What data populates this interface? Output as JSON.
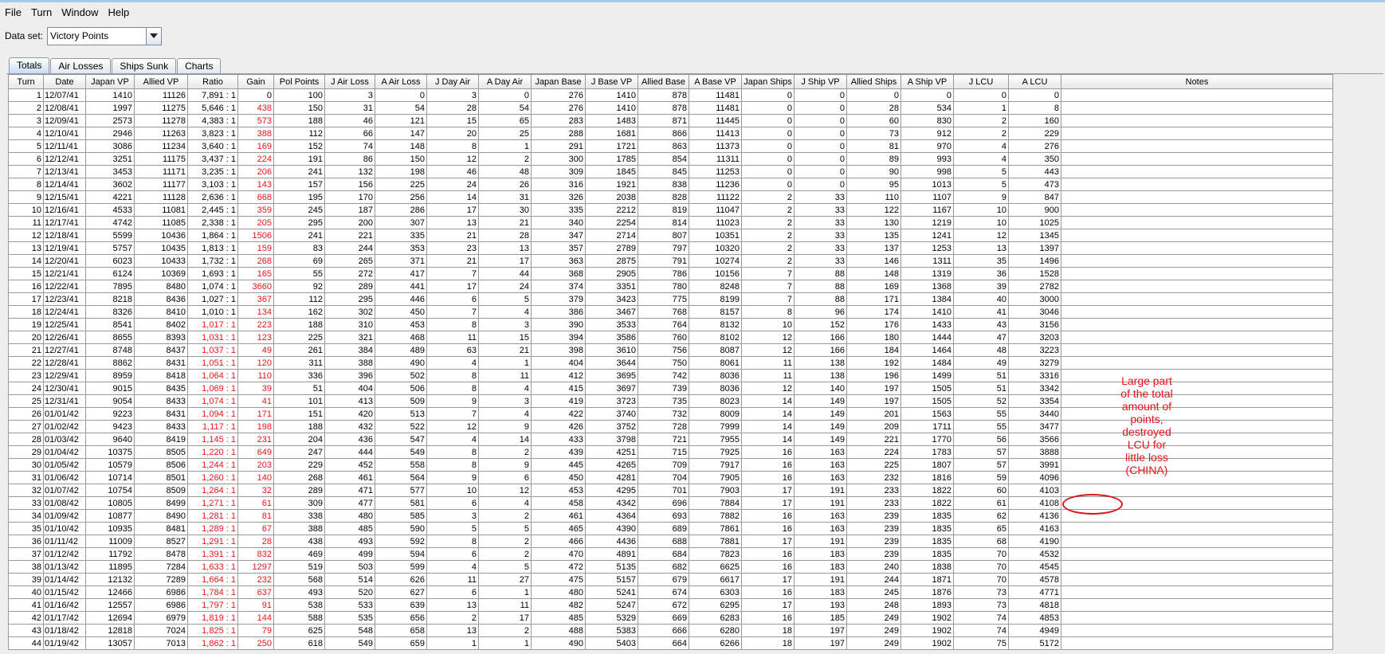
{
  "menu": [
    "File",
    "Turn",
    "Window",
    "Help"
  ],
  "toolbar": {
    "dataset_label": "Data set:",
    "dataset_value": "Victory Points"
  },
  "tabs": [
    "Totals",
    "Air Losses",
    "Ships Sunk",
    "Charts"
  ],
  "table": {
    "columns": [
      "Turn",
      "Date",
      "Japan VP",
      "Allied VP",
      "Ratio",
      "Gain",
      "Pol Points",
      "J Air Loss",
      "A Air Loss",
      "J Day Air",
      "A Day Air",
      "Japan Base",
      "J Base VP",
      "Allied Base",
      "A Base VP",
      "Japan Ships",
      "J Ship VP",
      "Allied Ships",
      "A Ship VP",
      "J LCU",
      "A LCU",
      "Notes"
    ],
    "rows": [
      [
        "1",
        "12/07/41",
        "1410",
        "11126",
        "7,891 : 1",
        "0",
        "100",
        "3",
        "0",
        "3",
        "0",
        "276",
        "1410",
        "878",
        "11481",
        "0",
        "0",
        "0",
        "0",
        "0",
        "0",
        ""
      ],
      [
        "2",
        "12/08/41",
        "1997",
        "11275",
        "5,646 : 1",
        "438",
        "150",
        "31",
        "54",
        "28",
        "54",
        "276",
        "1410",
        "878",
        "11481",
        "0",
        "0",
        "28",
        "534",
        "1",
        "8",
        ""
      ],
      [
        "3",
        "12/09/41",
        "2573",
        "11278",
        "4,383 : 1",
        "573",
        "188",
        "46",
        "121",
        "15",
        "65",
        "283",
        "1483",
        "871",
        "11445",
        "0",
        "0",
        "60",
        "830",
        "2",
        "160",
        ""
      ],
      [
        "4",
        "12/10/41",
        "2946",
        "11263",
        "3,823 : 1",
        "388",
        "112",
        "66",
        "147",
        "20",
        "25",
        "288",
        "1681",
        "866",
        "11413",
        "0",
        "0",
        "73",
        "912",
        "2",
        "229",
        ""
      ],
      [
        "5",
        "12/11/41",
        "3086",
        "11234",
        "3,640 : 1",
        "169",
        "152",
        "74",
        "148",
        "8",
        "1",
        "291",
        "1721",
        "863",
        "11373",
        "0",
        "0",
        "81",
        "970",
        "4",
        "276",
        ""
      ],
      [
        "6",
        "12/12/41",
        "3251",
        "11175",
        "3,437 : 1",
        "224",
        "191",
        "86",
        "150",
        "12",
        "2",
        "300",
        "1785",
        "854",
        "11311",
        "0",
        "0",
        "89",
        "993",
        "4",
        "350",
        ""
      ],
      [
        "7",
        "12/13/41",
        "3453",
        "11171",
        "3,235 : 1",
        "206",
        "241",
        "132",
        "198",
        "46",
        "48",
        "309",
        "1845",
        "845",
        "11253",
        "0",
        "0",
        "90",
        "998",
        "5",
        "443",
        ""
      ],
      [
        "8",
        "12/14/41",
        "3602",
        "11177",
        "3,103 : 1",
        "143",
        "157",
        "156",
        "225",
        "24",
        "26",
        "316",
        "1921",
        "838",
        "11236",
        "0",
        "0",
        "95",
        "1013",
        "5",
        "473",
        ""
      ],
      [
        "9",
        "12/15/41",
        "4221",
        "11128",
        "2,636 : 1",
        "668",
        "195",
        "170",
        "256",
        "14",
        "31",
        "326",
        "2038",
        "828",
        "11122",
        "2",
        "33",
        "110",
        "1107",
        "9",
        "847",
        ""
      ],
      [
        "10",
        "12/16/41",
        "4533",
        "11081",
        "2,445 : 1",
        "359",
        "245",
        "187",
        "286",
        "17",
        "30",
        "335",
        "2212",
        "819",
        "11047",
        "2",
        "33",
        "122",
        "1167",
        "10",
        "900",
        ""
      ],
      [
        "11",
        "12/17/41",
        "4742",
        "11085",
        "2,338 : 1",
        "205",
        "295",
        "200",
        "307",
        "13",
        "21",
        "340",
        "2254",
        "814",
        "11023",
        "2",
        "33",
        "130",
        "1219",
        "10",
        "1025",
        ""
      ],
      [
        "12",
        "12/18/41",
        "5599",
        "10436",
        "1,864 : 1",
        "1506",
        "241",
        "221",
        "335",
        "21",
        "28",
        "347",
        "2714",
        "807",
        "10351",
        "2",
        "33",
        "135",
        "1241",
        "12",
        "1345",
        ""
      ],
      [
        "13",
        "12/19/41",
        "5757",
        "10435",
        "1,813 : 1",
        "159",
        "83",
        "244",
        "353",
        "23",
        "13",
        "357",
        "2789",
        "797",
        "10320",
        "2",
        "33",
        "137",
        "1253",
        "13",
        "1397",
        ""
      ],
      [
        "14",
        "12/20/41",
        "6023",
        "10433",
        "1,732 : 1",
        "268",
        "69",
        "265",
        "371",
        "21",
        "17",
        "363",
        "2875",
        "791",
        "10274",
        "2",
        "33",
        "146",
        "1311",
        "35",
        "1496",
        ""
      ],
      [
        "15",
        "12/21/41",
        "6124",
        "10369",
        "1,693 : 1",
        "165",
        "55",
        "272",
        "417",
        "7",
        "44",
        "368",
        "2905",
        "786",
        "10156",
        "7",
        "88",
        "148",
        "1319",
        "36",
        "1528",
        ""
      ],
      [
        "16",
        "12/22/41",
        "7895",
        "8480",
        "1,074 : 1",
        "3660",
        "92",
        "289",
        "441",
        "17",
        "24",
        "374",
        "3351",
        "780",
        "8248",
        "7",
        "88",
        "169",
        "1368",
        "39",
        "2782",
        ""
      ],
      [
        "17",
        "12/23/41",
        "8218",
        "8436",
        "1,027 : 1",
        "367",
        "112",
        "295",
        "446",
        "6",
        "5",
        "379",
        "3423",
        "775",
        "8199",
        "7",
        "88",
        "171",
        "1384",
        "40",
        "3000",
        ""
      ],
      [
        "18",
        "12/24/41",
        "8326",
        "8410",
        "1,010 : 1",
        "134",
        "162",
        "302",
        "450",
        "7",
        "4",
        "386",
        "3467",
        "768",
        "8157",
        "8",
        "96",
        "174",
        "1410",
        "41",
        "3046",
        ""
      ],
      [
        "19",
        "12/25/41",
        "8541",
        "8402",
        "1,017 : 1",
        "223",
        "188",
        "310",
        "453",
        "8",
        "3",
        "390",
        "3533",
        "764",
        "8132",
        "10",
        "152",
        "176",
        "1433",
        "43",
        "3156",
        ""
      ],
      [
        "20",
        "12/26/41",
        "8655",
        "8393",
        "1,031 : 1",
        "123",
        "225",
        "321",
        "468",
        "11",
        "15",
        "394",
        "3586",
        "760",
        "8102",
        "12",
        "166",
        "180",
        "1444",
        "47",
        "3203",
        ""
      ],
      [
        "21",
        "12/27/41",
        "8748",
        "8437",
        "1,037 : 1",
        "49",
        "261",
        "384",
        "489",
        "63",
        "21",
        "398",
        "3610",
        "756",
        "8087",
        "12",
        "166",
        "184",
        "1464",
        "48",
        "3223",
        ""
      ],
      [
        "22",
        "12/28/41",
        "8862",
        "8431",
        "1,051 : 1",
        "120",
        "311",
        "388",
        "490",
        "4",
        "1",
        "404",
        "3644",
        "750",
        "8061",
        "11",
        "138",
        "192",
        "1484",
        "49",
        "3279",
        ""
      ],
      [
        "23",
        "12/29/41",
        "8959",
        "8418",
        "1,064 : 1",
        "110",
        "336",
        "396",
        "502",
        "8",
        "11",
        "412",
        "3695",
        "742",
        "8036",
        "11",
        "138",
        "196",
        "1499",
        "51",
        "3316",
        ""
      ],
      [
        "24",
        "12/30/41",
        "9015",
        "8435",
        "1,069 : 1",
        "39",
        "51",
        "404",
        "506",
        "8",
        "4",
        "415",
        "3697",
        "739",
        "8036",
        "12",
        "140",
        "197",
        "1505",
        "51",
        "3342",
        ""
      ],
      [
        "25",
        "12/31/41",
        "9054",
        "8433",
        "1,074 : 1",
        "41",
        "101",
        "413",
        "509",
        "9",
        "3",
        "419",
        "3723",
        "735",
        "8023",
        "14",
        "149",
        "197",
        "1505",
        "52",
        "3354",
        ""
      ],
      [
        "26",
        "01/01/42",
        "9223",
        "8431",
        "1,094 : 1",
        "171",
        "151",
        "420",
        "513",
        "7",
        "4",
        "422",
        "3740",
        "732",
        "8009",
        "14",
        "149",
        "201",
        "1563",
        "55",
        "3440",
        ""
      ],
      [
        "27",
        "01/02/42",
        "9423",
        "8433",
        "1,117 : 1",
        "198",
        "188",
        "432",
        "522",
        "12",
        "9",
        "426",
        "3752",
        "728",
        "7999",
        "14",
        "149",
        "209",
        "1711",
        "55",
        "3477",
        ""
      ],
      [
        "28",
        "01/03/42",
        "9640",
        "8419",
        "1,145 : 1",
        "231",
        "204",
        "436",
        "547",
        "4",
        "14",
        "433",
        "3798",
        "721",
        "7955",
        "14",
        "149",
        "221",
        "1770",
        "56",
        "3566",
        ""
      ],
      [
        "29",
        "01/04/42",
        "10375",
        "8505",
        "1,220 : 1",
        "649",
        "247",
        "444",
        "549",
        "8",
        "2",
        "439",
        "4251",
        "715",
        "7925",
        "16",
        "163",
        "224",
        "1783",
        "57",
        "3888",
        ""
      ],
      [
        "30",
        "01/05/42",
        "10579",
        "8506",
        "1,244 : 1",
        "203",
        "229",
        "452",
        "558",
        "8",
        "9",
        "445",
        "4265",
        "709",
        "7917",
        "16",
        "163",
        "225",
        "1807",
        "57",
        "3991",
        ""
      ],
      [
        "31",
        "01/06/42",
        "10714",
        "8501",
        "1,260 : 1",
        "140",
        "268",
        "461",
        "564",
        "9",
        "6",
        "450",
        "4281",
        "704",
        "7905",
        "16",
        "163",
        "232",
        "1816",
        "59",
        "4096",
        ""
      ],
      [
        "32",
        "01/07/42",
        "10754",
        "8509",
        "1,264 : 1",
        "32",
        "289",
        "471",
        "577",
        "10",
        "12",
        "453",
        "4295",
        "701",
        "7903",
        "17",
        "191",
        "233",
        "1822",
        "60",
        "4103",
        ""
      ],
      [
        "33",
        "01/08/42",
        "10805",
        "8499",
        "1,271 : 1",
        "61",
        "309",
        "477",
        "581",
        "6",
        "4",
        "458",
        "4342",
        "696",
        "7884",
        "17",
        "191",
        "233",
        "1822",
        "61",
        "4108",
        ""
      ],
      [
        "34",
        "01/09/42",
        "10877",
        "8490",
        "1,281 : 1",
        "81",
        "338",
        "480",
        "585",
        "3",
        "2",
        "461",
        "4364",
        "693",
        "7882",
        "16",
        "163",
        "239",
        "1835",
        "62",
        "4136",
        ""
      ],
      [
        "35",
        "01/10/42",
        "10935",
        "8481",
        "1,289 : 1",
        "67",
        "388",
        "485",
        "590",
        "5",
        "5",
        "465",
        "4390",
        "689",
        "7861",
        "16",
        "163",
        "239",
        "1835",
        "65",
        "4163",
        ""
      ],
      [
        "36",
        "01/11/42",
        "11009",
        "8527",
        "1,291 : 1",
        "28",
        "438",
        "493",
        "592",
        "8",
        "2",
        "466",
        "4436",
        "688",
        "7881",
        "17",
        "191",
        "239",
        "1835",
        "68",
        "4190",
        ""
      ],
      [
        "37",
        "01/12/42",
        "11792",
        "8478",
        "1,391 : 1",
        "832",
        "469",
        "499",
        "594",
        "6",
        "2",
        "470",
        "4891",
        "684",
        "7823",
        "16",
        "183",
        "239",
        "1835",
        "70",
        "4532",
        ""
      ],
      [
        "38",
        "01/13/42",
        "11895",
        "7284",
        "1,633 : 1",
        "1297",
        "519",
        "503",
        "599",
        "4",
        "5",
        "472",
        "5135",
        "682",
        "6625",
        "16",
        "183",
        "240",
        "1838",
        "70",
        "4545",
        ""
      ],
      [
        "39",
        "01/14/42",
        "12132",
        "7289",
        "1,664 : 1",
        "232",
        "568",
        "514",
        "626",
        "11",
        "27",
        "475",
        "5157",
        "679",
        "6617",
        "17",
        "191",
        "244",
        "1871",
        "70",
        "4578",
        ""
      ],
      [
        "40",
        "01/15/42",
        "12466",
        "6986",
        "1,784 : 1",
        "637",
        "493",
        "520",
        "627",
        "6",
        "1",
        "480",
        "5241",
        "674",
        "6303",
        "16",
        "183",
        "245",
        "1876",
        "73",
        "4771",
        ""
      ],
      [
        "41",
        "01/16/42",
        "12557",
        "6986",
        "1,797 : 1",
        "91",
        "538",
        "533",
        "639",
        "13",
        "11",
        "482",
        "5247",
        "672",
        "6295",
        "17",
        "193",
        "248",
        "1893",
        "73",
        "4818",
        ""
      ],
      [
        "42",
        "01/17/42",
        "12694",
        "6979",
        "1,819 : 1",
        "144",
        "588",
        "535",
        "656",
        "2",
        "17",
        "485",
        "5329",
        "669",
        "6283",
        "16",
        "185",
        "249",
        "1902",
        "74",
        "4853",
        ""
      ],
      [
        "43",
        "01/18/42",
        "12818",
        "7024",
        "1,825 : 1",
        "79",
        "625",
        "548",
        "658",
        "13",
        "2",
        "488",
        "5383",
        "666",
        "6280",
        "18",
        "197",
        "249",
        "1902",
        "74",
        "4949",
        ""
      ],
      [
        "44",
        "01/19/42",
        "13057",
        "7013",
        "1,862 : 1",
        "250",
        "618",
        "549",
        "659",
        "1",
        "1",
        "490",
        "5403",
        "664",
        "6266",
        "18",
        "197",
        "249",
        "1902",
        "75",
        "5172",
        ""
      ]
    ]
  },
  "annotation": "Large part of the total amount of points, destroyed LCU for little loss (CHINA)",
  "colors": {
    "highlight": "#e8141a",
    "tab_active": "#c9ddf0"
  }
}
